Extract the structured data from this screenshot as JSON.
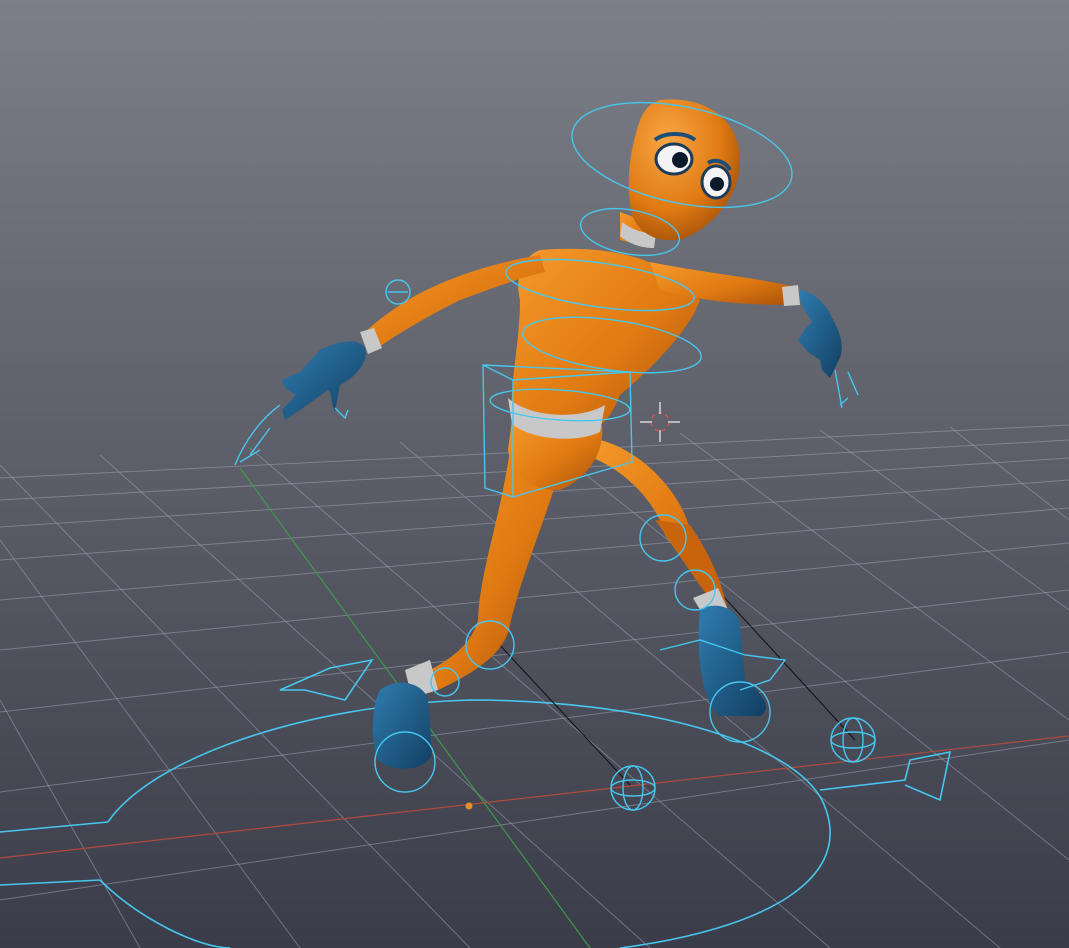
{
  "viewport": {
    "label": "",
    "colors": {
      "background_top": "#7c7f86",
      "background_bottom": "#3a3c49",
      "grid": "#9aa3b0",
      "rig_controls": "#47c6ee",
      "skin": "#e07a12",
      "hands_feet": "#1d5d8a",
      "bands": "#c8c8c8",
      "axis_x": "#b04a3c",
      "axis_y": "#3d9a4a",
      "origin_dot": "#e8902a"
    }
  },
  "character": {
    "description_icon": "orange-rigged-character"
  }
}
